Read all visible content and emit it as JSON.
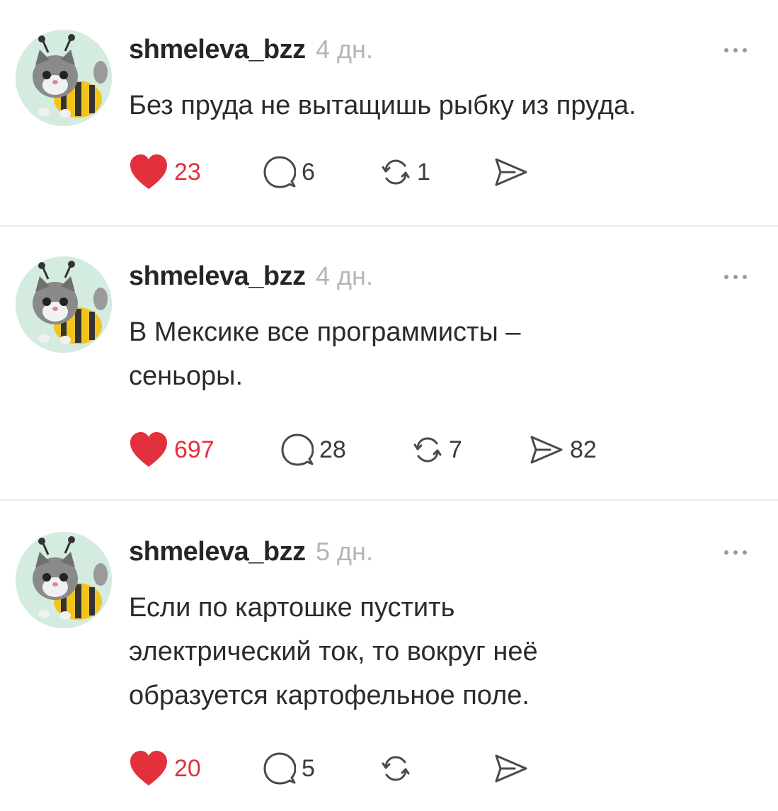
{
  "posts": [
    {
      "username": "shmeleva_bzz",
      "time": "4 дн.",
      "text_lines": [
        "Без пруда не вытащишь рыбку из пруда."
      ],
      "likes": "23",
      "comments": "6",
      "reposts": "1",
      "shares": ""
    },
    {
      "username": "shmeleva_bzz",
      "time": "4 дн.",
      "text_lines": [
        "В Мексике все программисты –",
        "сеньоры."
      ],
      "likes": "697",
      "comments": "28",
      "reposts": "7",
      "shares": "82"
    },
    {
      "username": "shmeleva_bzz",
      "time": "5 дн.",
      "text_lines": [
        "Если по картошке пустить",
        "электрический ток, то вокруг неё",
        "образуется картофельное поле."
      ],
      "likes": "20",
      "comments": "5",
      "reposts": "",
      "shares": ""
    }
  ],
  "icons": {
    "like": "heart-icon",
    "comment": "comment-bubble-icon",
    "repost": "repost-icon",
    "share": "share-send-icon",
    "more": "more-dots-icon"
  },
  "colors": {
    "like_red": "#e2313c",
    "avatar_bg": "#d3ecdf",
    "muted_text": "#b5b5b5"
  }
}
